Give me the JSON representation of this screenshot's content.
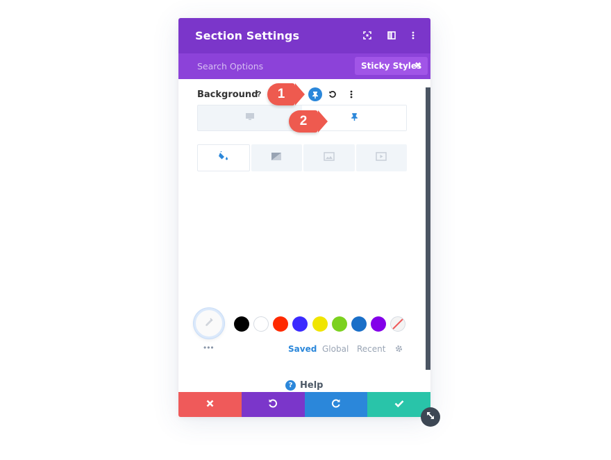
{
  "header": {
    "title": "Section Settings"
  },
  "subbar": {
    "search_placeholder": "Search Options",
    "filter_tag": "Sticky Styles",
    "filter_close": "✖"
  },
  "background": {
    "label": "Background",
    "help_glyph": "?"
  },
  "callouts": {
    "one": "1",
    "two": "2"
  },
  "color_tabs": {
    "saved": "Saved",
    "global": "Global",
    "recent": "Recent"
  },
  "swatches": [
    "#000000",
    "#ffffff",
    "#ff2a00",
    "#3b2bff",
    "#f0e500",
    "#7cd11f",
    "#1a6fc8",
    "#8300e9"
  ],
  "colors": {
    "purple_header": "#7b36ca",
    "purple_subbar": "#8c42d9",
    "accent_blue": "#2b87da",
    "cancel": "#ef5a5a",
    "undo": "#7b36ca",
    "redo": "#2b87da",
    "save": "#29c4a9"
  },
  "help": {
    "label": "Help"
  },
  "more_dots": "•••"
}
